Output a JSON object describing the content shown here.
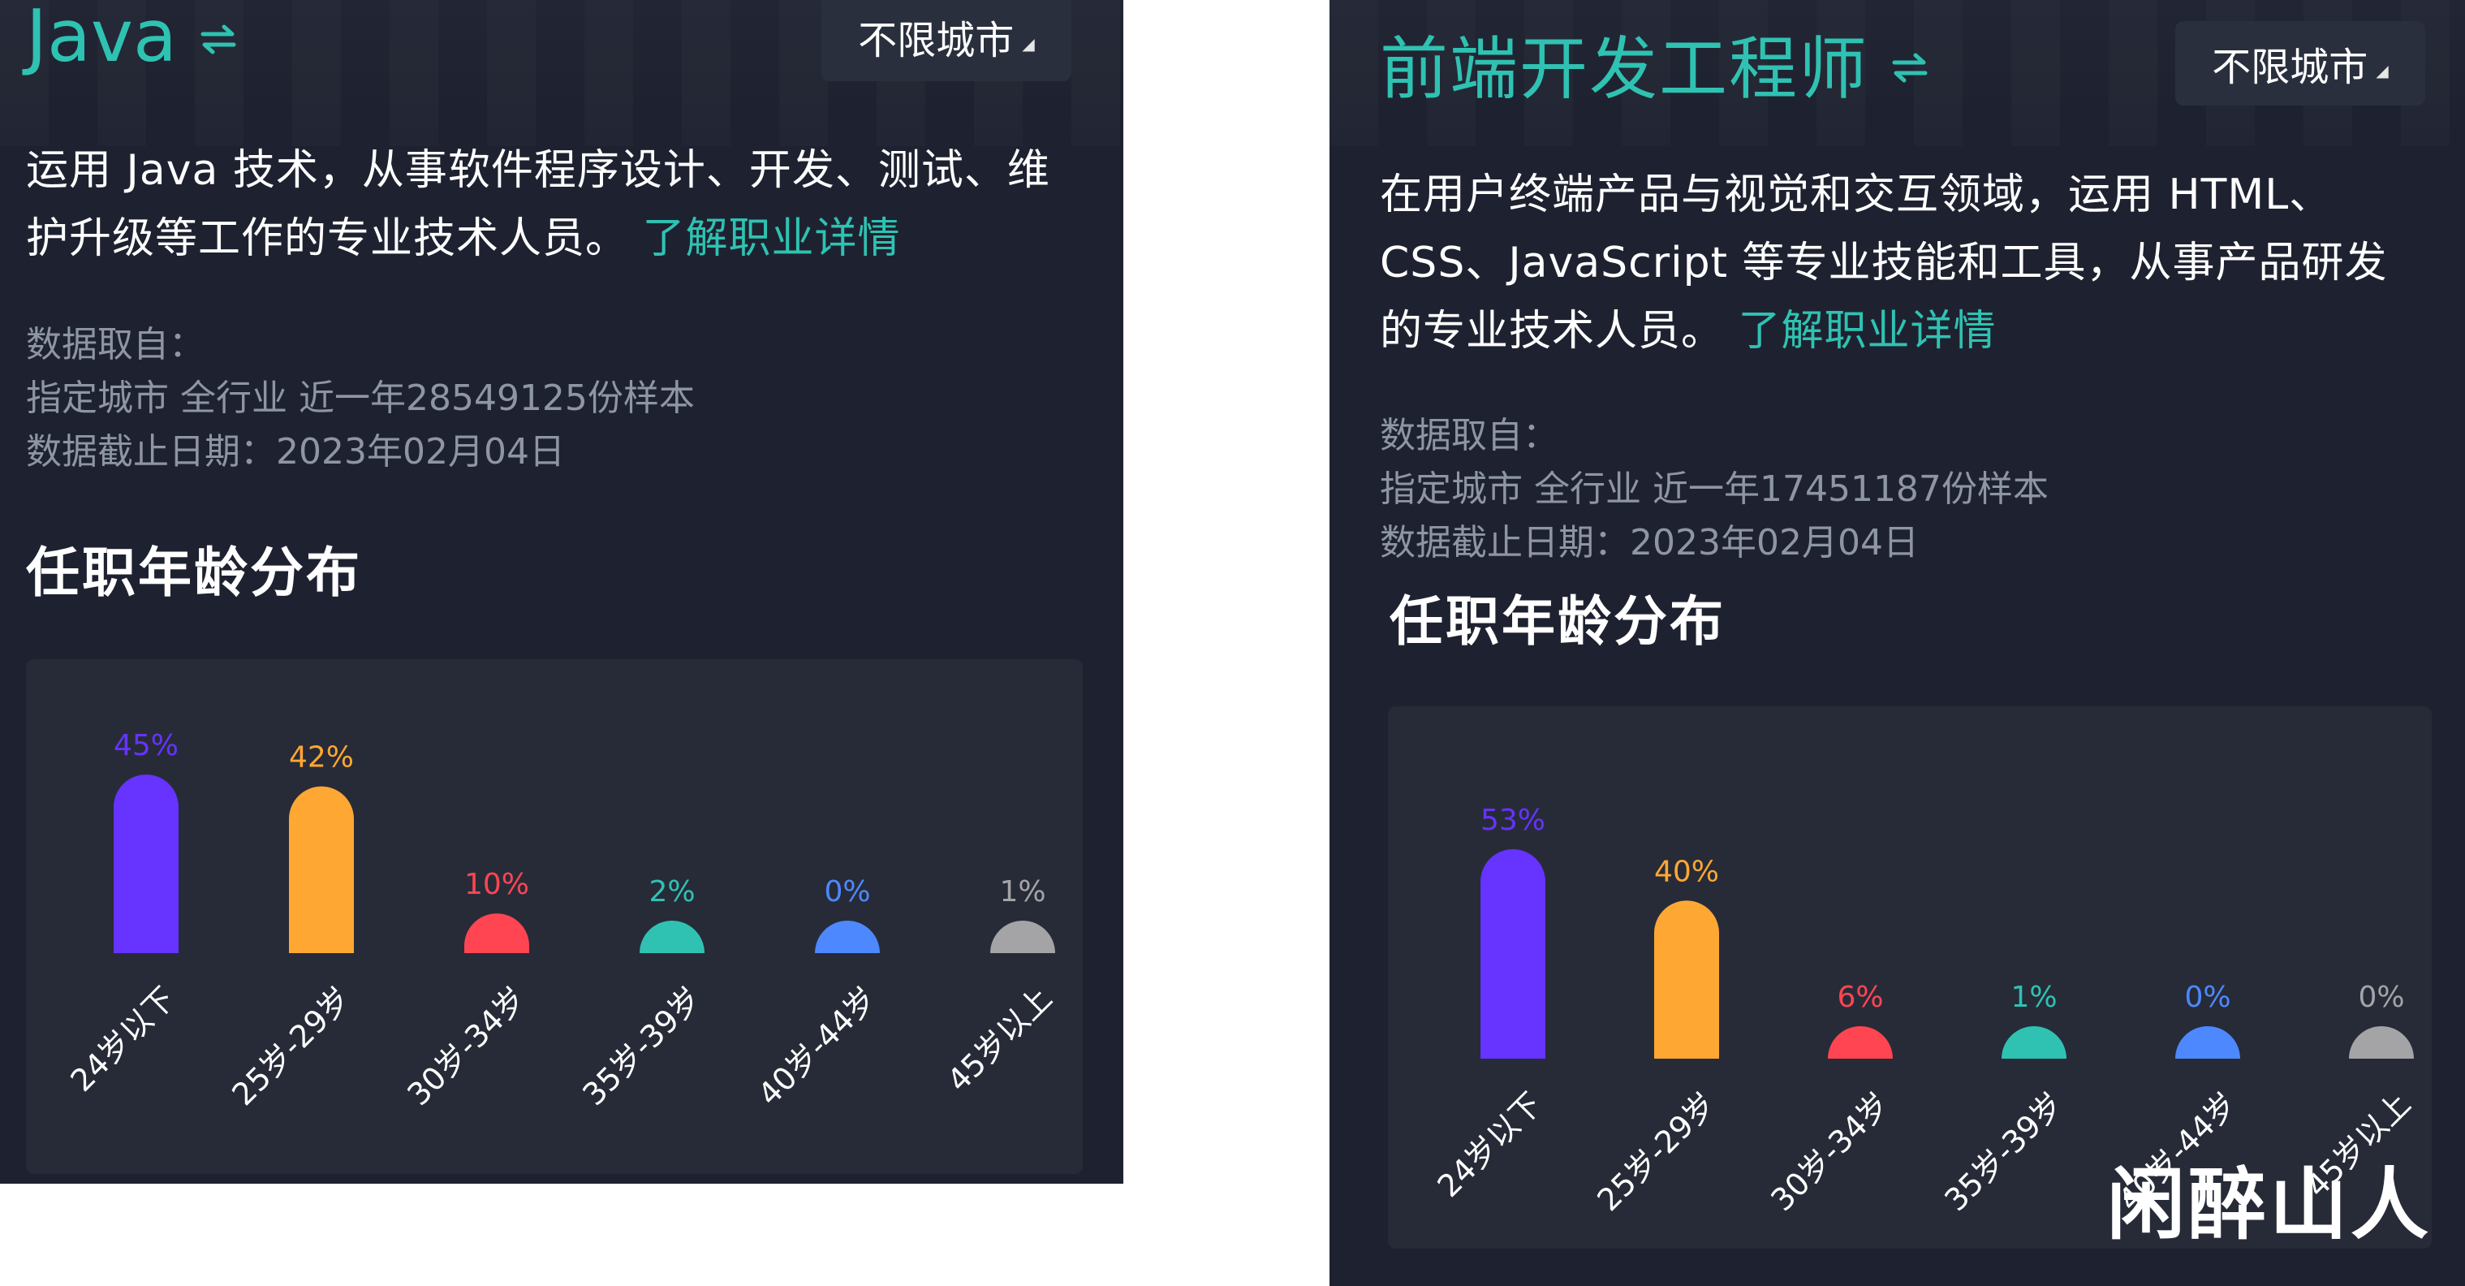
{
  "colors": {
    "panel_bg": "#1e2230",
    "card_bg": "#272b38",
    "accent": "#2fc2b2",
    "muted_text": "#8e95a3",
    "series_colors": [
      "#6633ff",
      "#ffa733",
      "#ff4552",
      "#2fc2b2",
      "#4d88ff",
      "#a4a4a6"
    ]
  },
  "left": {
    "job_title": "Java",
    "swap_icon": "swap-arrows-icon",
    "city_button": "不限城市",
    "description_lines": [
      "运用 Java 技术，从事软件程序设计、开发、测试、维",
      "护升级等工作的专业技术人员。"
    ],
    "more_link": "了解职业详情",
    "meta_label": "数据取自：",
    "meta_sample": "指定城市 全行业 近一年28549125份样本",
    "meta_date": "数据截止日期：2023年02月04日",
    "section_title": "任职年龄分布"
  },
  "right": {
    "job_title": "前端开发工程师",
    "swap_icon": "swap-arrows-icon",
    "city_button": "不限城市",
    "description_lines": [
      "在用户终端产品与视觉和交互领域，运用 HTML、",
      "CSS、JavaScript 等专业技能和工具，从事产品研发",
      "的专业技术人员。"
    ],
    "more_link": "了解职业详情",
    "meta_label": "数据取自：",
    "meta_sample": "指定城市 全行业 近一年17451187份样本",
    "meta_date": "数据截止日期：2023年02月04日",
    "section_title": "任职年龄分布"
  },
  "watermark": "闲醉山人",
  "chart_data": [
    {
      "type": "bar",
      "categories": [
        "24岁以下",
        "25岁-29岁",
        "30岁-34岁",
        "35岁-39岁",
        "40岁-44岁",
        "45岁以上"
      ],
      "values": [
        45,
        42,
        10,
        2,
        0,
        1
      ],
      "data_labels": [
        "45%",
        "42%",
        "10%",
        "2%",
        "0%",
        "1%"
      ],
      "title": "任职年龄分布",
      "xlabel": "",
      "ylabel": "",
      "unit": "%",
      "grid": false
    },
    {
      "type": "bar",
      "categories": [
        "24岁以下",
        "25岁-29岁",
        "30岁-34岁",
        "35岁-39岁",
        "40岁-44岁",
        "45岁以上"
      ],
      "values": [
        53,
        40,
        6,
        1,
        0,
        0
      ],
      "data_labels": [
        "53%",
        "40%",
        "6%",
        "1%",
        "0%",
        "0%"
      ],
      "title": "任职年龄分布",
      "xlabel": "",
      "ylabel": "",
      "unit": "%",
      "grid": false
    }
  ]
}
